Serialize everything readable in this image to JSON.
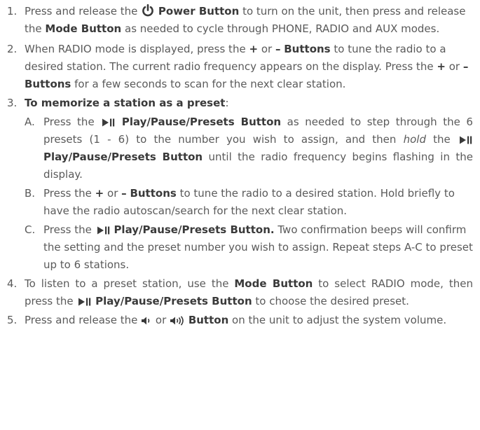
{
  "items": [
    {
      "num": "1.",
      "t1": "Press and release the",
      "b1": "Power Button",
      "t2": "to turn on the unit, then press and release the",
      "b2": "Mode Button",
      "t3": "as needed to cycle through PHONE,  RADIO and AUX modes."
    },
    {
      "num": "2.",
      "t1": "When RADIO mode is displayed, press the",
      "plus1": "+",
      "or1": "or",
      "minus1": "–",
      "b1": "Buttons",
      "t2": "to tune the radio to a desired station. The current radio frequency appears on the display. Press the",
      "plus2": "+",
      "or2": "or",
      "minus2": "–",
      "b2": "Buttons",
      "t3": "for a few seconds to scan for the next clear station."
    },
    {
      "num": "3.",
      "heading": "To memorize a station as a preset",
      "colon": ":",
      "subs": [
        {
          "letter": "A.",
          "t1": "Press the",
          "b1": "Play/Pause/Presets Button",
          "t2": "as needed to step through the 6 presets (1 - 6) to the number you wish to assign, and then",
          "em": "hold",
          "t3": "the",
          "b2": "Play/Pause/Presets Button",
          "t4": "until the radio frequency begins flashing in the display."
        },
        {
          "letter": "B.",
          "t1": "Press the",
          "plus": "+",
          "or": "or",
          "minus": "–",
          "b1": "Buttons",
          "t2": "to tune the radio to a desired station. Hold briefly to have the radio autoscan/search for the next clear station."
        },
        {
          "letter": "C.",
          "t1": "Press the",
          "b1": "Play/Pause/Presets Button.",
          "t2": "Two confirmation beeps will confirm the setting and the preset number you wish to assign. Repeat steps A-C to preset up to 6 stations."
        }
      ]
    },
    {
      "num": "4.",
      "t1": "To listen to a preset station, use the",
      "b1": "Mode Button",
      "t2": "to select RADIO mode, then press the",
      "b2": "Play/Pause/Presets Button",
      "t3": "to choose the desired preset."
    },
    {
      "num": "5.",
      "t1": "Press and release the",
      "or": "or",
      "b1": "Button",
      "t2": "on the unit to adjust the system volume."
    }
  ],
  "icons": {
    "power": "power-icon",
    "play_pause": "play-pause-icon",
    "volume_down": "volume-down-icon",
    "volume_up": "volume-up-icon"
  },
  "colors": {
    "text": "#5a5a5a",
    "bold": "#3a3a3a"
  }
}
